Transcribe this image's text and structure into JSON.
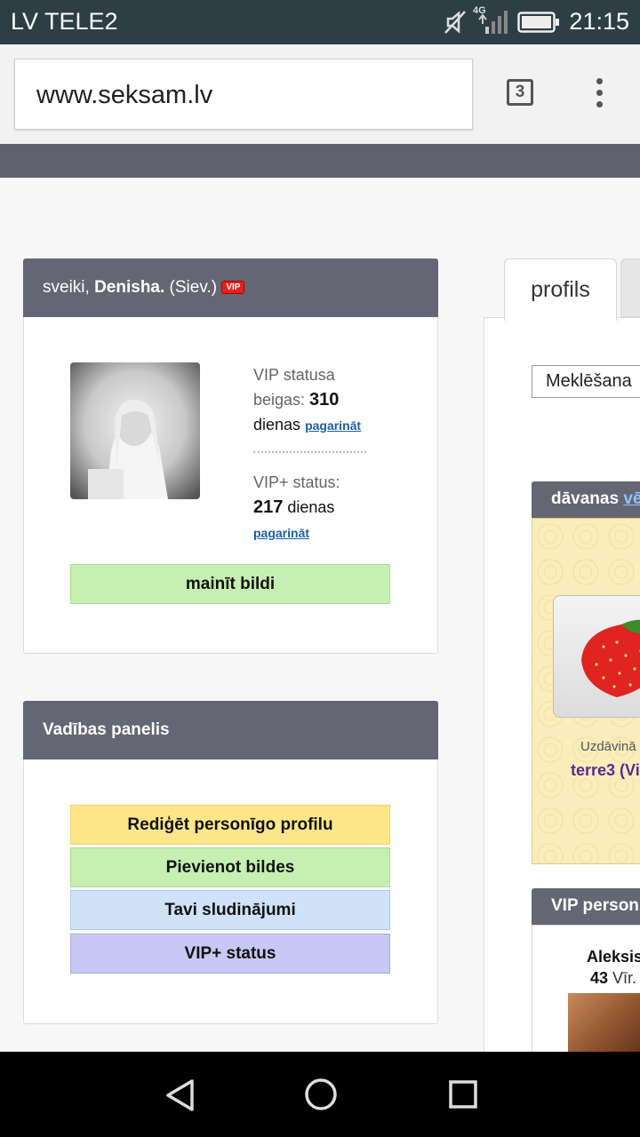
{
  "status_bar": {
    "carrier": "LV TELE2",
    "network": "4G",
    "time": "21:15"
  },
  "browser": {
    "url": "www.seksam.lv",
    "tab_count": "3"
  },
  "greeting": {
    "prefix": "sveiki, ",
    "username": "Denisha.",
    "gender": " (Siev.)",
    "vip_badge": "VIP"
  },
  "vip": {
    "status_label_1": "VIP statusa",
    "status_label_2": "beigas: ",
    "days": "310",
    "days_unit": "dienas",
    "extend_link": "pagarināt",
    "plus_label": "VIP+ status:",
    "plus_days": "217",
    "plus_days_unit": " dienas",
    "plus_extend_link": "pagarināt"
  },
  "change_photo_button": "mainīt bildi",
  "control_panel": {
    "title": "Vadības panelis",
    "buttons": [
      {
        "label": "Rediģēt personīgo profilu",
        "color": "#fde68a"
      },
      {
        "label": "Pievienot bildes",
        "color": "#c6efb1"
      },
      {
        "label": "Tavi sludinājumi",
        "color": "#cfe2f7"
      },
      {
        "label": "VIP+ status",
        "color": "#c8c8f5"
      }
    ]
  },
  "right": {
    "tab_profile": "profils",
    "search_button": "Meklēšana",
    "gifts_title": "dāvanas",
    "gifts_more": "vē",
    "gift_given_by": "Uzdāvinā",
    "gift_giver": "terre3 (Vi",
    "vip_people_title": "VIP person",
    "vip_person_name": "Aleksis",
    "vip_person_age": "43",
    "vip_person_gender": " Vīr."
  },
  "colors": {
    "status_bar": "#2d3e45",
    "panel_header": "#656673",
    "vip_badge": "#e2231a"
  },
  "icons": {
    "mute": "mute-icon",
    "signal": "signal-icon",
    "battery": "battery-icon",
    "menu": "overflow-menu-icon",
    "back": "back-triangle-icon",
    "home": "home-circle-icon",
    "recents": "recents-square-icon"
  }
}
